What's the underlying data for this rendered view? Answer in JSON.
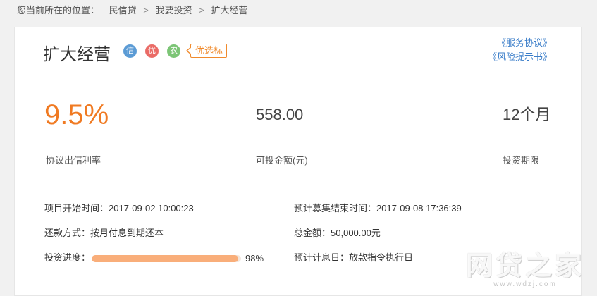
{
  "breadcrumb": {
    "prefix": "您当前所在的位置：",
    "items": [
      "民信贷",
      "我要投资",
      "扩大经营"
    ],
    "separator": ">"
  },
  "loan": {
    "title": "扩大经营",
    "tags": [
      "信",
      "优",
      "农"
    ],
    "flag_label": "优选标",
    "links": [
      "《服务协议》",
      "《风险提示书》"
    ]
  },
  "stats": {
    "rate_value": "9.5%",
    "rate_label": "协议出借利率",
    "amount_value": "558.00",
    "amount_label": "可投金额(元)",
    "term_value": "12个月",
    "term_label": "投资期限"
  },
  "details": {
    "start_label": "项目开始时间：",
    "start_value": "2017-09-02 10:00:23",
    "end_label": "预计募集结束时间：",
    "end_value": "2017-09-08 17:36:39",
    "repay_label": "还款方式：",
    "repay_value": "按月付息到期还本",
    "total_label": "总金额：",
    "total_value": "50,000.00元",
    "progress_label": "投资进度：",
    "progress_value": "98%",
    "progress_percent": 98,
    "interest_label": "预计计息日：",
    "interest_value": "放款指令执行日"
  },
  "watermark": {
    "main": "网贷之家",
    "sub": "www.wdzj.com"
  },
  "colors": {
    "accent": "#f07a22",
    "link": "#3a7dc9",
    "progress": "#f9ae7a"
  }
}
